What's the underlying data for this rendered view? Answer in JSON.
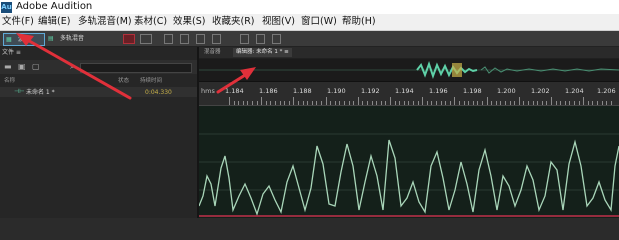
{
  "window": {
    "title": "Adobe Audition",
    "app_icon": "Au"
  },
  "menu": [
    {
      "label": "文件(F)"
    },
    {
      "label": "编辑(E)"
    },
    {
      "label": "多轨混音(M)"
    },
    {
      "label": "素材(C)"
    },
    {
      "label": "效果(S)"
    },
    {
      "label": "收藏夹(R)"
    },
    {
      "label": "视图(V)"
    },
    {
      "label": "窗口(W)"
    },
    {
      "label": "帮助(H)"
    }
  ],
  "toolbar": {
    "waveform_label": "波形",
    "multitrack_label": "多轨混音"
  },
  "files_panel": {
    "tab": "文件 ≡",
    "columns": {
      "name": "名称",
      "status": "状态",
      "duration": "持续时间"
    },
    "rows": [
      {
        "name": "未命名 1 *",
        "duration": "0:04.330"
      }
    ]
  },
  "editor": {
    "tabs": [
      {
        "label": "混音器"
      },
      {
        "label": "编辑器: 未命名 1 * ≡"
      }
    ],
    "ruler": {
      "unit": "hms",
      "ticks": [
        "1.184",
        "1.186",
        "1.188",
        "1.190",
        "1.192",
        "1.194",
        "1.196",
        "1.198",
        "1.200",
        "1.202",
        "1.204",
        "1.206"
      ]
    }
  },
  "colors": {
    "waveform": "#a9d6b9",
    "overview_wave": "#5fd1a8",
    "arrow": "#e0303a",
    "selection_line": "#c0304a"
  }
}
